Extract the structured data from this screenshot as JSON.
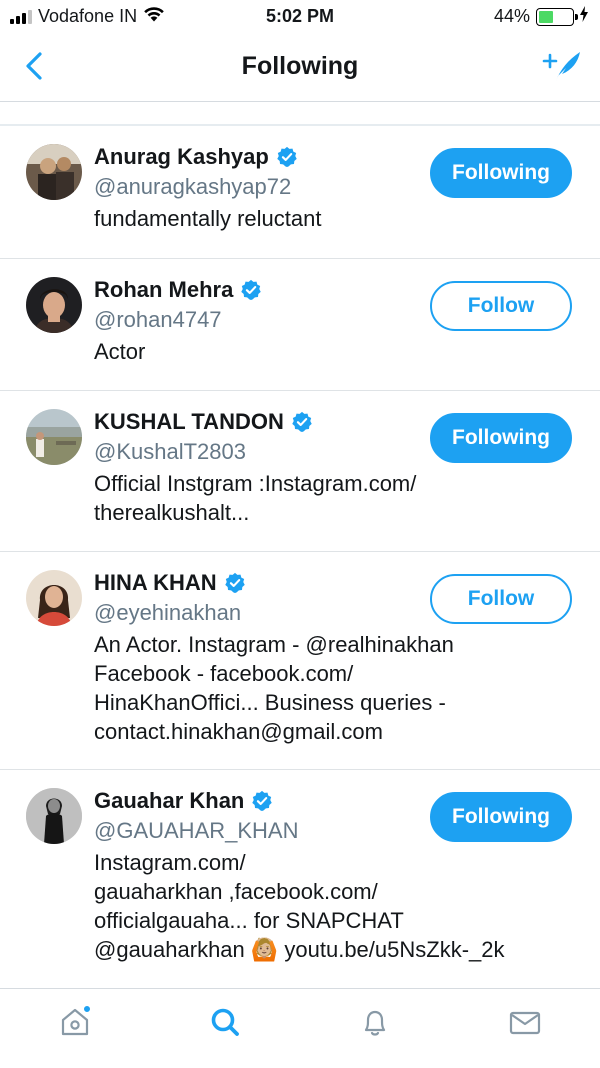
{
  "status_bar": {
    "carrier": "Vodafone IN",
    "time": "5:02 PM",
    "battery_percent": "44%",
    "battery_level": 0.44,
    "signal_bars_active": 3,
    "signal_bars_total": 4
  },
  "nav": {
    "title": "Following",
    "back_icon": "chevron-left-icon",
    "compose_icon": "add-feather-icon"
  },
  "colors": {
    "accent": "#1da1f2",
    "text": "#14171a",
    "secondary": "#657786"
  },
  "users": [
    {
      "name": "Anurag Kashyap",
      "handle": "@anuragkashyap72",
      "bio": "fundamentally reluctant",
      "verified": true,
      "button": "Following",
      "is_following": true
    },
    {
      "name": "Rohan Mehra",
      "handle": "@rohan4747",
      "bio": "Actor",
      "verified": true,
      "button": "Follow",
      "is_following": false
    },
    {
      "name": "KUSHAL TANDON",
      "handle": "@KushalT2803",
      "bio": "Official Instgram :Instagram.com/\ntherealkushalt...",
      "verified": true,
      "button": "Following",
      "is_following": true
    },
    {
      "name": "HINA KHAN",
      "handle": "@eyehinakhan",
      "bio": "An Actor. Instagram - @realhinakhan\nFacebook - facebook.com/\nHinaKhanOffici... Business queries -\ncontact.hinakhan@gmail.com",
      "verified": true,
      "button": "Follow",
      "is_following": false
    },
    {
      "name": "Gauahar Khan",
      "handle": "@GAUAHAR_KHAN",
      "bio": "Instagram.com/\ngauaharkhan ,facebook.com/\nofficialgauaha... for SNAPCHAT\n@gauaharkhan 🙆🏼 youtu.be/u5NsZkk-_2k",
      "verified": true,
      "button": "Following",
      "is_following": true
    }
  ],
  "tab_bar": {
    "tabs": [
      "home-icon",
      "search-icon",
      "notifications-bell-icon",
      "messages-envelope-icon"
    ],
    "active_tab": "search-icon",
    "home_has_notification": true
  }
}
